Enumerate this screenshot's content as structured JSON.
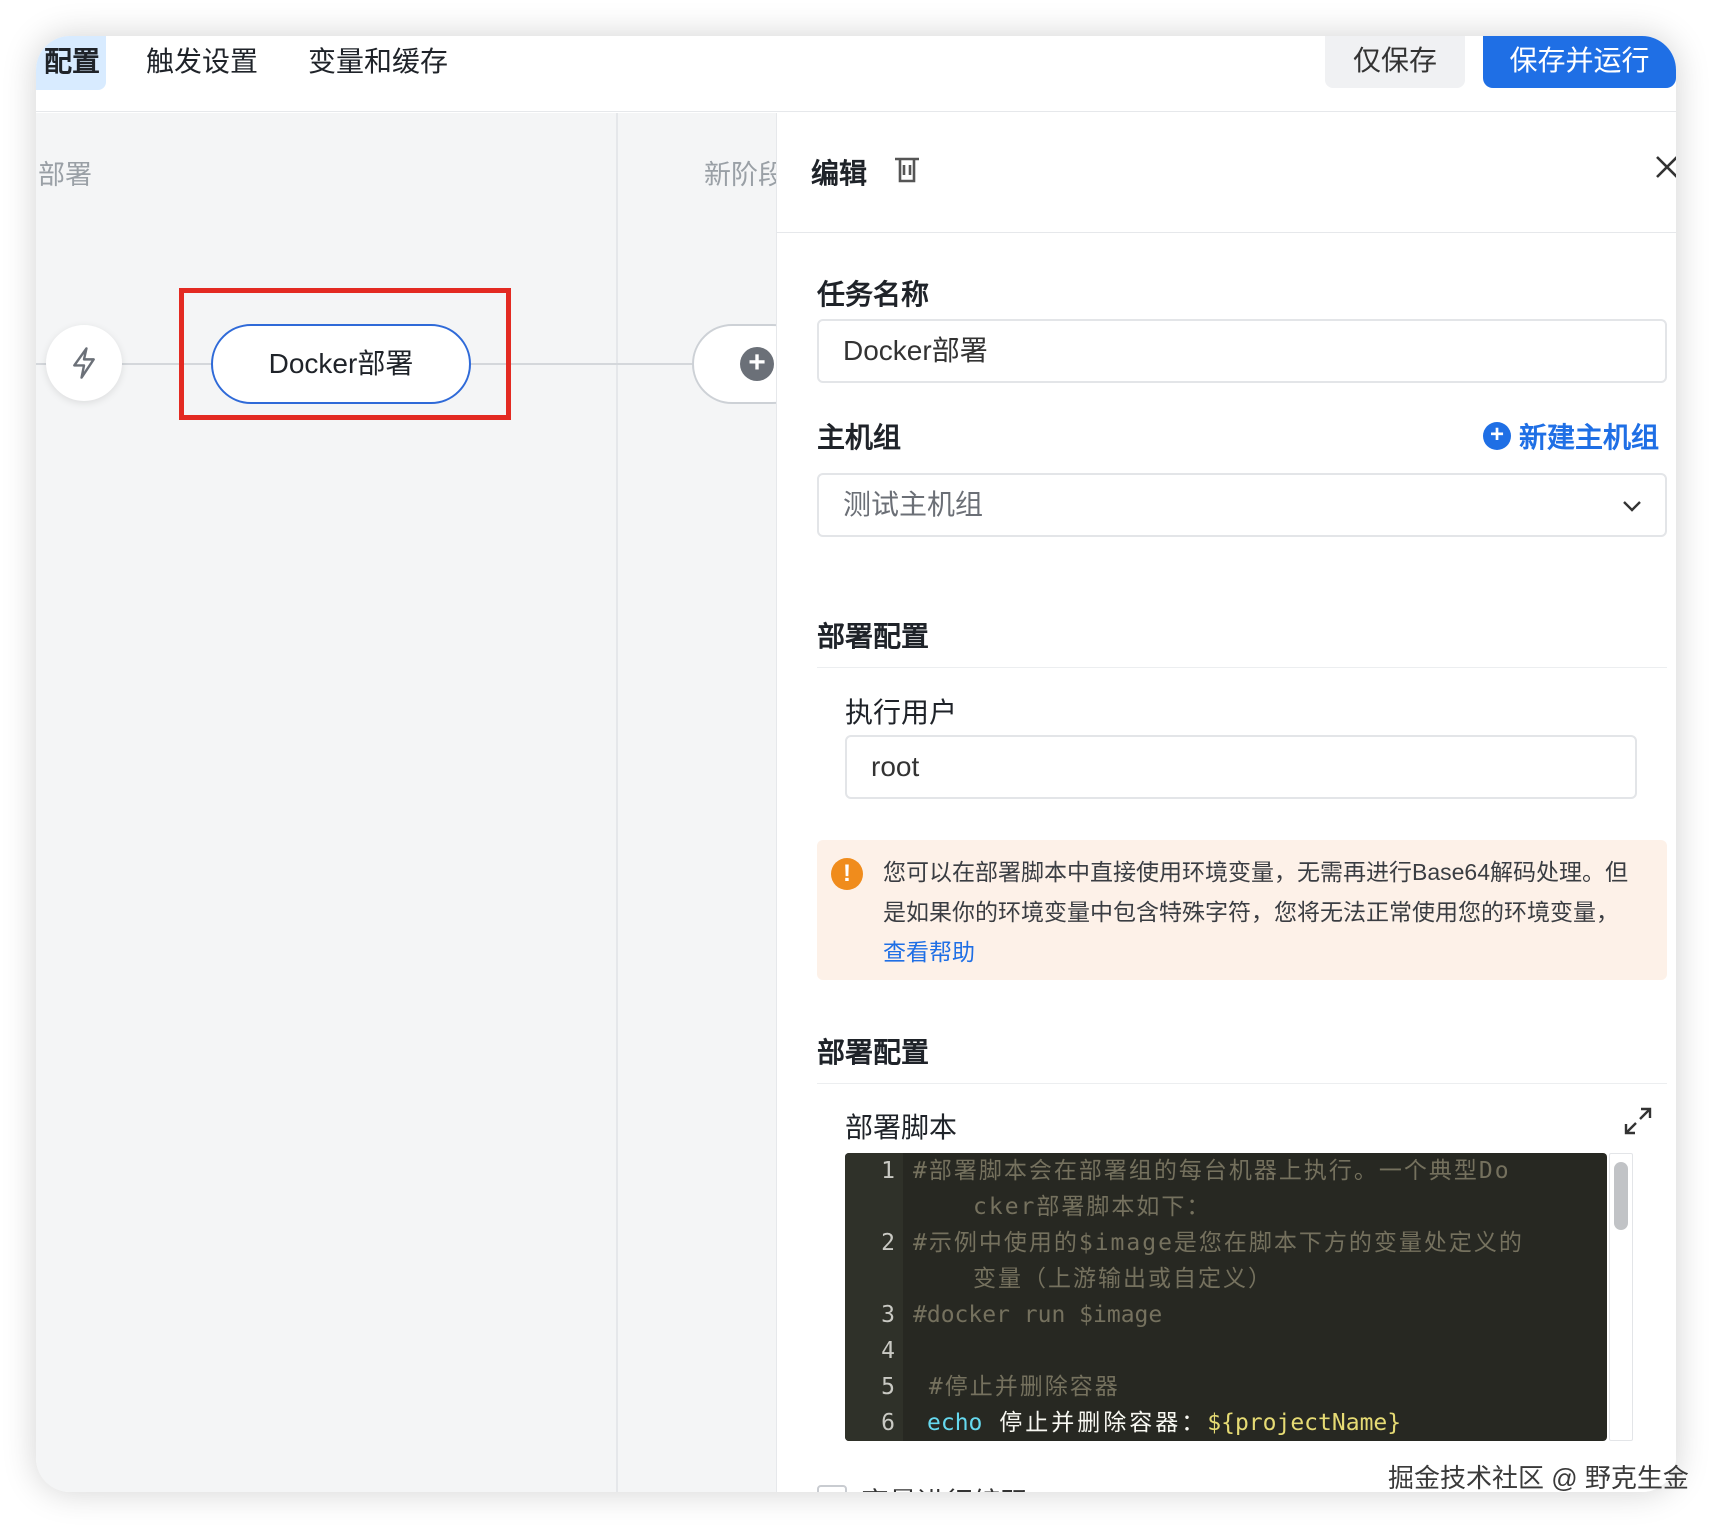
{
  "topbar": {
    "tabs": [
      {
        "label": "配置置"
      },
      {
        "label": "触发设置"
      },
      {
        "label": "变量和缓存"
      }
    ],
    "visible_active_tab": "配置",
    "save_only_label": "仅保存",
    "save_and_run_label": "保存并运行"
  },
  "canvas": {
    "stage1_title": "部署",
    "stage2_title": "新阶段",
    "task_node_label": "Docker部署",
    "trigger_icon": "lightning-icon",
    "add_icon": "plus-circle-icon"
  },
  "panel": {
    "title": "编辑",
    "delete_icon": "trash-icon",
    "close_icon": "close-icon",
    "task_name_label": "任务名称",
    "task_name_value": "Docker部署",
    "host_group_label": "主机组",
    "new_host_group_label": "新建主机组",
    "host_group_value": "测试主机组",
    "deploy_config_label": "部署配置",
    "exec_user_label": "执行用户",
    "exec_user_value": "root",
    "alert_text": "您可以在部署脚本中直接使用环境变量，无需再进行Base64解码处理。但是如果你的环境变量中包含特殊字符，您将无法正常使用您的环境变量，",
    "alert_link": "查看帮助",
    "deploy_config_label_2": "部署配置",
    "deploy_script_label": "部署脚本",
    "expand_icon": "expand-icon",
    "encode_var_label": "变量进行编码"
  },
  "script": {
    "lines": [
      {
        "num": "1",
        "text": "#部署脚本会在部署组的每台机器上执行。一个典型Do",
        "cont": "cker部署脚本如下："
      },
      {
        "num": "2",
        "text": "#示例中使用的$image是您在脚本下方的变量处定义的",
        "cont": "变量（上游输出或自定义）"
      },
      {
        "num": "3",
        "text": "#docker run $image"
      },
      {
        "num": "4",
        "text": ""
      },
      {
        "num": "5",
        "text": " #停止并删除容器"
      },
      {
        "num": "6",
        "kw": "echo",
        "plain": " 停止并删除容器：",
        "var": "${projectName}"
      }
    ]
  },
  "watermark": "掘金技术社区 @ 野克生金",
  "colors": {
    "accent": "#1f6fe5",
    "highlight_box": "#e32a22",
    "warning": "#f08c1c",
    "editor_bg": "#272822"
  }
}
